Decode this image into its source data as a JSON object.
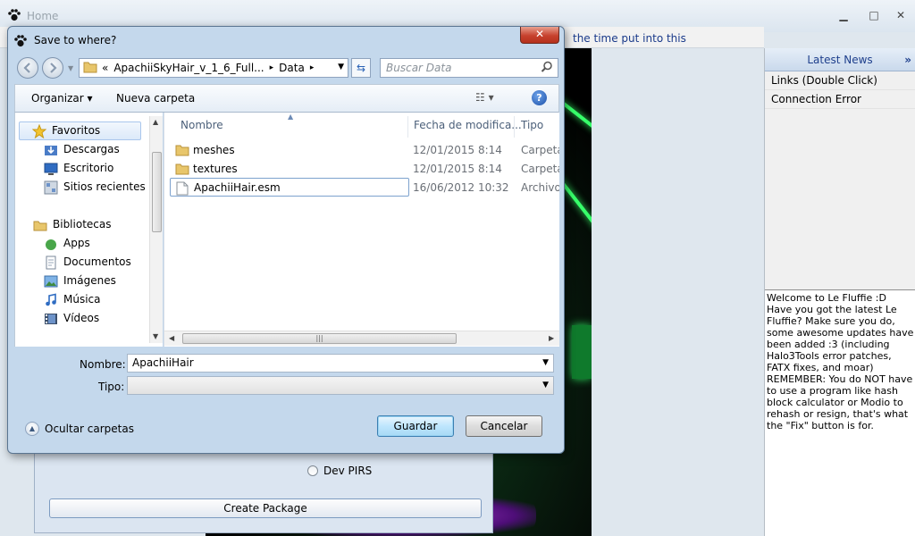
{
  "main_window": {
    "title": "Home",
    "ticker_text": "the time put into this",
    "controls": {
      "minimize": "▁",
      "maximize": "□",
      "close": "✕"
    }
  },
  "left_panel": {
    "dev_pirs_label": "Dev PIRS",
    "create_package_label": "Create Package"
  },
  "news_panel": {
    "header": "Latest News",
    "chevron": "»",
    "items": [
      "Links (Double Click)",
      "Connection Error"
    ],
    "message": "Welcome to Le Fluffie :D\nHave you got the latest Le Fluffie? Make sure you do, some awesome updates have been added :3 (including Halo3Tools error patches, FATX fixes, and moar)\nREMEMBER: You do NOT have to use a program like hash block calculator or Modio to rehash or resign, that's what the \"Fix\" button is for."
  },
  "dialog": {
    "title": "Save to where?",
    "close_label": "✕",
    "address": {
      "prefix": "«",
      "crumbs": [
        "ApachiiSkyHair_v_1_6_Full...",
        "Data"
      ],
      "separator": "▸"
    },
    "search_placeholder": "Buscar Data",
    "toolbar": {
      "organize": "Organizar ▾",
      "new_folder": "Nueva carpeta",
      "view": "☷  ▾",
      "help": "?"
    },
    "nav_items": [
      {
        "label": "Favoritos",
        "icon": "star-icon"
      },
      {
        "label": "Descargas",
        "icon": "downloads-icon"
      },
      {
        "label": "Escritorio",
        "icon": "desktop-icon"
      },
      {
        "label": "Sitios recientes",
        "icon": "recent-places-icon"
      },
      {
        "label": "Bibliotecas",
        "icon": "libraries-icon"
      },
      {
        "label": "Apps",
        "icon": "apps-icon"
      },
      {
        "label": "Documentos",
        "icon": "documents-icon"
      },
      {
        "label": "Imágenes",
        "icon": "pictures-icon"
      },
      {
        "label": "Música",
        "icon": "music-icon"
      },
      {
        "label": "Vídeos",
        "icon": "videos-icon"
      }
    ],
    "columns": [
      "Nombre",
      "Fecha de modifica...",
      "Tipo"
    ],
    "files": [
      {
        "name": "meshes",
        "date": "12/01/2015 8:14",
        "type": "Carpeta d",
        "icon": "folder-icon"
      },
      {
        "name": "textures",
        "date": "12/01/2015 8:14",
        "type": "Carpeta d",
        "icon": "folder-icon"
      },
      {
        "name": "ApachiiHair.esm",
        "date": "16/06/2012 10:32",
        "type": "Archivo E",
        "icon": "file-icon"
      }
    ],
    "form": {
      "name_label": "Nombre:",
      "name_value": "ApachiiHair",
      "type_label": "Tipo:",
      "type_value": ""
    },
    "hide_folders": "Ocultar carpetas",
    "save_label": "Guardar",
    "cancel_label": "Cancelar"
  },
  "colors": {
    "dialog_frame": "#c4d8ec",
    "accent_blue": "#1e3f8c",
    "close_red": "#c7422e",
    "laser_green": "#37ff6a"
  }
}
